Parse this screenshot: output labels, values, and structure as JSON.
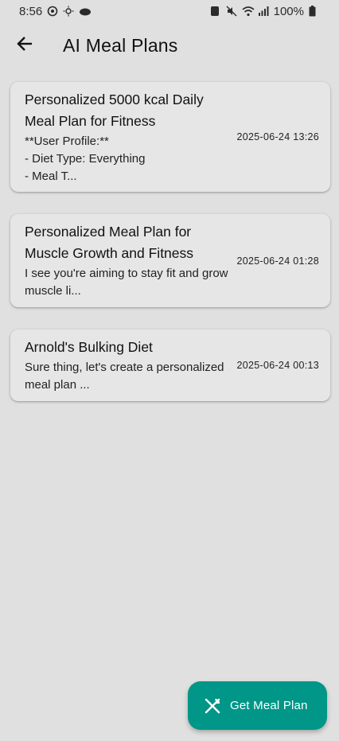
{
  "status_bar": {
    "time": "8:56",
    "battery": "100%"
  },
  "app_bar": {
    "title": "AI Meal Plans",
    "back_icon": "arrow-back-icon"
  },
  "plans": [
    {
      "title": "Personalized 5000 kcal Daily Meal Plan for Fitness",
      "preview": "**User Profile:**\n- Diet Type: Everything\n- Meal T...",
      "date": "2025-06-24 13:26"
    },
    {
      "title": "Personalized Meal Plan for Muscle Growth and Fitness",
      "preview": "I see you're aiming to stay fit and grow muscle li...",
      "date": "2025-06-24 01:28"
    },
    {
      "title": "Arnold's Bulking Diet",
      "preview": "Sure thing, let's create a personalized meal plan ...",
      "date": "2025-06-24 00:13"
    }
  ],
  "fab": {
    "label": "Get Meal Plan",
    "icon": "utensils-icon"
  },
  "colors": {
    "background": "#e0e0e0",
    "card": "#e6e6e6",
    "accent": "#009688"
  }
}
